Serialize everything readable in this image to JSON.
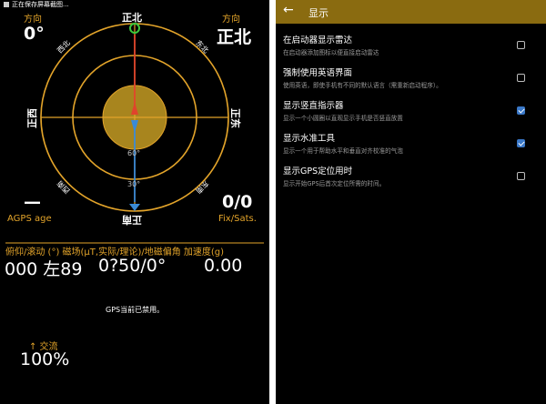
{
  "status_bar": {
    "text": "正在保存屏幕截图..."
  },
  "compass": {
    "north": "正北",
    "south": "正南",
    "east": "正东",
    "west": "正西",
    "northwest": "西北",
    "northeast": "东北",
    "southwest": "西南",
    "southeast": "东南",
    "ring_60": "60°",
    "ring_30": "30°"
  },
  "gps_info": {
    "direction_label_left": "方向",
    "direction_value_left": "0°",
    "direction_label_right": "方向",
    "direction_value_right": "正北",
    "agps_value": "—",
    "agps_label": "AGPS age",
    "fix_value": "0/0",
    "fix_label": "Fix/Sats."
  },
  "sensors": {
    "header": "俯仰/滚动 (°) 磁场(μT,实际/理论)/地磁偏角  加速度(g)",
    "pitch_roll": "000 左89",
    "magnetic": "0?50/0°",
    "acceleration": "0.00"
  },
  "gps_status": "GPS当前已禁用。",
  "battery": {
    "label": "↑ 交流",
    "value": "100%"
  },
  "settings_screen": {
    "title": "显示",
    "items": [
      {
        "title": "在启动器显示雷达",
        "subtitle": "在启动器添加图标以便直接启动雷达",
        "checked": false
      },
      {
        "title": "强制使用英语界面",
        "subtitle": "使用英语，即使手机有不同的默认语言（需重新启动程序）。",
        "checked": false
      },
      {
        "title": "显示竖直指示器",
        "subtitle": "显示一个小圆圈以直观显示手机是否竖直放置",
        "checked": true
      },
      {
        "title": "显示水准工具",
        "subtitle": "显示一个用于帮助水平和垂直对齐校准的气泡",
        "checked": true
      },
      {
        "title": "显示GPS定位用时",
        "subtitle": "显示开始GPS后首次定位所需的时间。",
        "checked": false
      }
    ]
  },
  "colors": {
    "accent_gold": "#e3a42a",
    "app_bar": "#8a6b10",
    "checkbox_blue": "#3a78c8",
    "background": "#000000"
  }
}
